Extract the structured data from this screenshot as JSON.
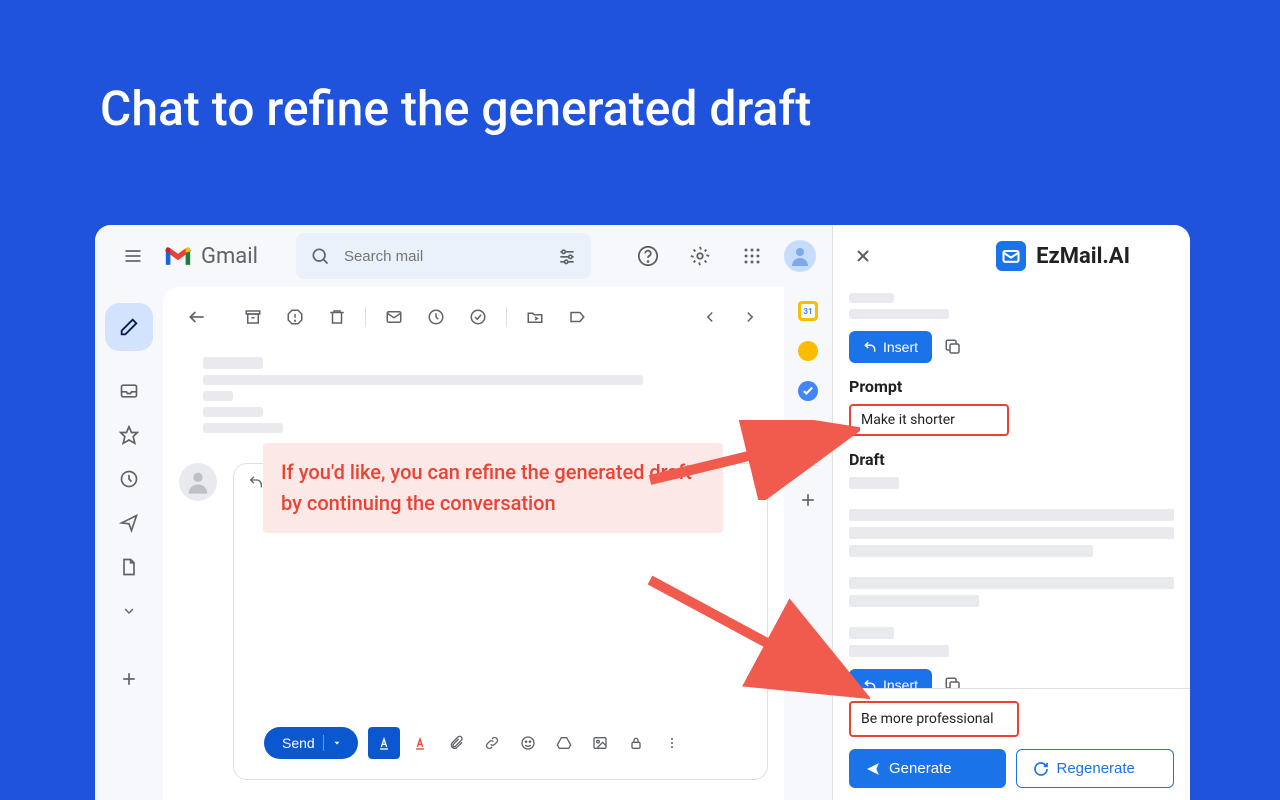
{
  "hero": {
    "title": "Chat to refine the generated draft"
  },
  "gmail": {
    "brand": "Gmail",
    "search_placeholder": "Search mail",
    "send_label": "Send"
  },
  "callout": {
    "text": "If you'd like, you can refine the generated draft by continuing the conversation"
  },
  "ezmail": {
    "title": "EzMail.AI",
    "insert_label_1": "Insert",
    "prompt_label": "Prompt",
    "prompt_value": "Make it shorter",
    "draft_label": "Draft",
    "insert_label_2": "Insert",
    "input_value": "Be more professional",
    "generate_label": "Generate",
    "regenerate_label": "Regenerate"
  }
}
